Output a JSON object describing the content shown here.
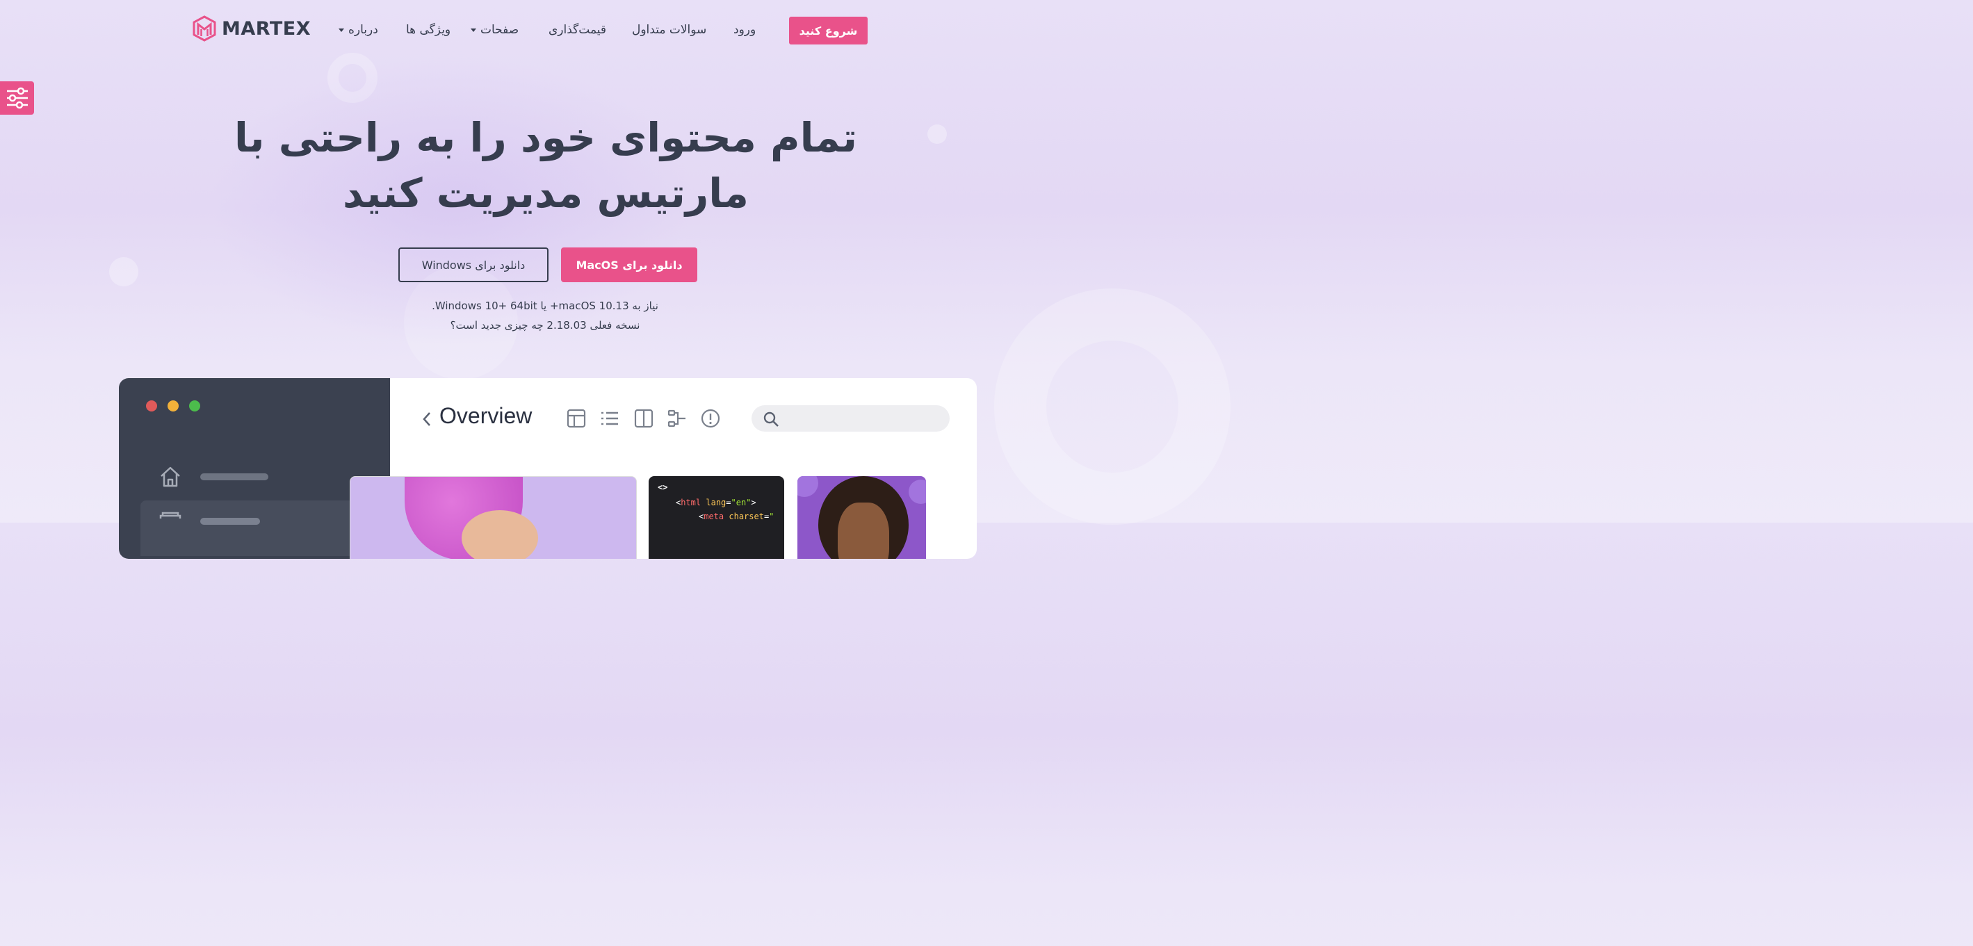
{
  "brand": {
    "name": "MARTEX",
    "accent": "#e9528a",
    "dark": "#363d4e"
  },
  "nav": {
    "items": [
      {
        "label": "درباره",
        "has_dropdown": true
      },
      {
        "label": "ویژگی ها",
        "has_dropdown": false
      },
      {
        "label": "صفحات",
        "has_dropdown": true
      },
      {
        "label": "قیمت‌گذاری",
        "has_dropdown": false
      },
      {
        "label": "سوالات متداول",
        "has_dropdown": false
      },
      {
        "label": "ورود",
        "has_dropdown": false
      }
    ],
    "cta": "شروع کنید"
  },
  "settings_icon": "sliders-icon",
  "hero": {
    "title_line1": "تمام محتوای خود را به راحتی با",
    "title_line2": "مارتیس مدیریت کنید",
    "btn_mac": "دانلود برای MacOS",
    "btn_windows": "دانلود برای Windows",
    "requirements": "نیاز به macOS 10.13+ یا Windows 10+ 64bit.",
    "version": "نسخه فعلی 2.18.03  چه چیزی جدید است؟"
  },
  "app_preview": {
    "title": "Overview",
    "window_dots": [
      "#e05a5a",
      "#f2b13a",
      "#4cbc4c"
    ],
    "toolbar_icons": [
      "table-icon",
      "list-icon",
      "columns-icon",
      "flow-icon",
      "alert-icon"
    ],
    "search_placeholder": "",
    "code_lines": [
      "<>",
      "<html lang=\"en\">",
      "<meta charset=\""
    ]
  }
}
